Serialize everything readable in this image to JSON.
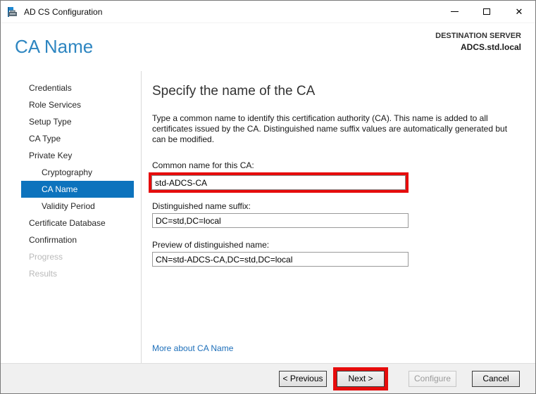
{
  "window": {
    "title": "AD CS Configuration",
    "icons": {
      "app": "adcs-app-icon",
      "minimize": "minimize-icon",
      "maximize": "maximize-icon",
      "close": "close-icon"
    },
    "close_glyph": "✕"
  },
  "header": {
    "page_title": "CA Name",
    "destination_label": "DESTINATION SERVER",
    "destination_server": "ADCS.std.local"
  },
  "sidebar": {
    "items": [
      {
        "label": "Credentials",
        "state": "enabled",
        "level": 0
      },
      {
        "label": "Role Services",
        "state": "enabled",
        "level": 0
      },
      {
        "label": "Setup Type",
        "state": "enabled",
        "level": 0
      },
      {
        "label": "CA Type",
        "state": "enabled",
        "level": 0
      },
      {
        "label": "Private Key",
        "state": "enabled",
        "level": 0
      },
      {
        "label": "Cryptography",
        "state": "enabled",
        "level": 1
      },
      {
        "label": "CA Name",
        "state": "selected",
        "level": 1
      },
      {
        "label": "Validity Period",
        "state": "enabled",
        "level": 1
      },
      {
        "label": "Certificate Database",
        "state": "enabled",
        "level": 0
      },
      {
        "label": "Confirmation",
        "state": "enabled",
        "level": 0
      },
      {
        "label": "Progress",
        "state": "disabled",
        "level": 0
      },
      {
        "label": "Results",
        "state": "disabled",
        "level": 0
      }
    ]
  },
  "content": {
    "heading": "Specify the name of the CA",
    "description": "Type a common name to identify this certification authority (CA). This name is added to all certificates issued by the CA. Distinguished name suffix values are automatically generated but can be modified.",
    "fields": [
      {
        "label": "Common name for this CA:",
        "value": "std-ADCS-CA",
        "highlighted": true
      },
      {
        "label": "Distinguished name suffix:",
        "value": "DC=std,DC=local",
        "highlighted": false
      },
      {
        "label": "Preview of distinguished name:",
        "value": "CN=std-ADCS-CA,DC=std,DC=local",
        "highlighted": false
      }
    ],
    "link": "More about CA Name"
  },
  "footer": {
    "buttons": [
      {
        "label": "< Previous",
        "state": "enabled",
        "highlighted": false
      },
      {
        "label": "Next >",
        "state": "enabled",
        "highlighted": true
      },
      {
        "label": "Configure",
        "state": "disabled",
        "highlighted": false
      },
      {
        "label": "Cancel",
        "state": "enabled",
        "highlighted": false
      }
    ]
  },
  "colors": {
    "sidebar_selected_blue": "#0d73bd",
    "page_title_blue": "#2e86c1",
    "link_blue": "#1d6fba",
    "annotation_red": "#e60c0c",
    "footer_gray": "#f0f0f0"
  }
}
